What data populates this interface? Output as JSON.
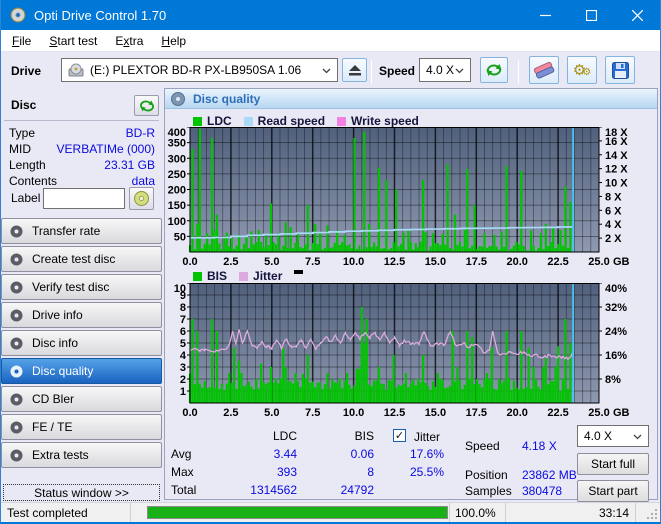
{
  "window": {
    "title": "Opti Drive Control 1.70"
  },
  "menu": {
    "items": [
      {
        "label": "File",
        "accel_index": 0
      },
      {
        "label": "Start test",
        "accel_index": 0
      },
      {
        "label": "Extra",
        "accel_index": 1
      },
      {
        "label": "Help",
        "accel_index": 0
      }
    ]
  },
  "toolbar": {
    "drive_label": "Drive",
    "drive_value": "(E:)   PLEXTOR BD-R  PX-LB950SA 1.06",
    "speed_label": "Speed",
    "speed_value": "4.0 X"
  },
  "disc_panel": {
    "title": "Disc",
    "rows": [
      {
        "label": "Type",
        "value": "BD-R"
      },
      {
        "label": "MID",
        "value": "VERBATIMe (000)"
      },
      {
        "label": "Length",
        "value": "23.31 GB"
      },
      {
        "label": "Contents",
        "value": "data"
      }
    ],
    "label_field": {
      "label": "Label",
      "value": ""
    }
  },
  "sidebar": {
    "items": [
      {
        "label": "Transfer rate"
      },
      {
        "label": "Create test disc"
      },
      {
        "label": "Verify test disc"
      },
      {
        "label": "Drive info"
      },
      {
        "label": "Disc info"
      },
      {
        "label": "Disc quality",
        "selected": true
      },
      {
        "label": "CD Bler"
      },
      {
        "label": "FE / TE"
      },
      {
        "label": "Extra tests"
      }
    ]
  },
  "status_window_button": "Status window >>",
  "main": {
    "header": "Disc quality"
  },
  "stats": {
    "columns": {
      "ldc": "LDC",
      "bis": "BIS",
      "jitter": "Jitter"
    },
    "jitter_checked": true,
    "rows": [
      {
        "label": "Avg",
        "ldc": "3.44",
        "bis": "0.06",
        "jitter": "17.6%"
      },
      {
        "label": "Max",
        "ldc": "393",
        "bis": "8",
        "jitter": "25.5%"
      },
      {
        "label": "Total",
        "ldc": "1314562",
        "bis": "24792",
        "jitter": ""
      }
    ],
    "right": {
      "speed_label": "Speed",
      "speed_value": "4.18 X",
      "position_label": "Position",
      "position_value": "23862 MB",
      "samples_label": "Samples",
      "samples_value": "380478"
    },
    "speed_select": "4.0 X",
    "buttons": {
      "start_full": "Start full",
      "start_part": "Start part"
    }
  },
  "statusbar": {
    "status": "Test completed",
    "progress_percent": "100.0%",
    "progress_value": 100,
    "elapsed": "33:14"
  },
  "chart_data": [
    {
      "type": "bar",
      "title": "Disc quality - LDC / Read speed / Write speed",
      "legend": [
        {
          "label": "LDC",
          "color": "#00c400"
        },
        {
          "label": "Read speed",
          "color": "#a8daf8"
        },
        {
          "label": "Write speed",
          "color": "#f281e4"
        }
      ],
      "x_axis": {
        "unit": "GB",
        "min": 0,
        "max": 25,
        "major_tick": 2.5,
        "minor_tick": 0.5,
        "ticks": [
          "0.0",
          "2.5",
          "5.0",
          "7.5",
          "10.0",
          "12.5",
          "15.0",
          "17.5",
          "20.0",
          "22.5",
          "25.0"
        ]
      },
      "left_axis": {
        "min": 0,
        "max": 400,
        "tick_step": 50
      },
      "right_axis": {
        "min": 0,
        "max": 18,
        "tick_step": 2,
        "suffix": " X"
      },
      "data_end_gb": 23.35,
      "plot_colors": {
        "bg_top": "#50607c",
        "bg_bottom": "#8f99b0"
      },
      "series": {
        "bars": {
          "name": "LDC",
          "color": "#00c400",
          "axis": "left",
          "step_gb": 0.15,
          "seed": 42,
          "baseline": [
            3,
            34
          ],
          "spikes": [
            [
              0.2,
              330
            ],
            [
              0.4,
              90
            ],
            [
              0.6,
              395
            ],
            [
              1.0,
              60
            ],
            [
              1.4,
              365
            ],
            [
              1.6,
              120
            ],
            [
              2.2,
              62
            ],
            [
              2.6,
              48
            ],
            [
              3.0,
              55
            ],
            [
              3.4,
              50
            ],
            [
              3.8,
              66
            ],
            [
              4.2,
              70
            ],
            [
              4.6,
              55
            ],
            [
              4.9,
              155
            ],
            [
              5.4,
              60
            ],
            [
              5.8,
              95
            ],
            [
              6.2,
              80
            ],
            [
              6.6,
              58
            ],
            [
              7.2,
              150
            ],
            [
              7.6,
              90
            ],
            [
              8.0,
              62
            ],
            [
              8.4,
              85
            ],
            [
              9.0,
              70
            ],
            [
              9.4,
              55
            ],
            [
              10.0,
              365
            ],
            [
              10.6,
              385
            ],
            [
              11.0,
              90
            ],
            [
              11.6,
              270
            ],
            [
              12.0,
              230
            ],
            [
              12.6,
              200
            ],
            [
              13.0,
              62
            ],
            [
              13.4,
              70
            ],
            [
              14.2,
              230
            ],
            [
              14.8,
              60
            ],
            [
              15.4,
              58
            ],
            [
              15.8,
              280
            ],
            [
              16.2,
              120
            ],
            [
              16.8,
              70
            ],
            [
              17.0,
              265
            ],
            [
              17.4,
              150
            ],
            [
              18.0,
              60
            ],
            [
              18.6,
              55
            ],
            [
              19.0,
              65
            ],
            [
              19.4,
              275
            ],
            [
              20.2,
              260
            ],
            [
              20.8,
              70
            ],
            [
              21.4,
              60
            ],
            [
              21.8,
              90
            ],
            [
              22.2,
              80
            ],
            [
              22.6,
              70
            ],
            [
              23.0,
              210
            ],
            [
              23.2,
              160
            ]
          ]
        },
        "lines": [
          {
            "name": "Read speed",
            "color": "#a8daf8",
            "axis": "right",
            "mode": "step",
            "width": 1.7,
            "points": [
              [
                0,
                2.05
              ],
              [
                1.5,
                2.1
              ],
              [
                2.5,
                2.25
              ],
              [
                3.5,
                2.4
              ],
              [
                4.5,
                2.5
              ],
              [
                5.5,
                2.6
              ],
              [
                6.5,
                2.7
              ],
              [
                7.5,
                2.8
              ],
              [
                8.5,
                2.9
              ],
              [
                9.5,
                3.0
              ],
              [
                10.5,
                3.05
              ],
              [
                11.5,
                3.12
              ],
              [
                12.5,
                3.2
              ],
              [
                13.5,
                3.25
              ],
              [
                14.5,
                3.3
              ],
              [
                15.5,
                3.35
              ],
              [
                16.5,
                3.4
              ],
              [
                17.5,
                3.42
              ],
              [
                18.5,
                3.45
              ],
              [
                19.5,
                3.5
              ],
              [
                20.5,
                3.52
              ],
              [
                21.5,
                3.55
              ],
              [
                22.5,
                3.6
              ],
              [
                23.35,
                3.62
              ]
            ]
          },
          {
            "name": "Write speed",
            "color": "#f281e4",
            "axis": "right",
            "mode": "step",
            "width": 1.7,
            "points": []
          }
        ],
        "end_marker": {
          "color": "#45c8f8",
          "x_gb": 23.42
        }
      }
    },
    {
      "type": "bar",
      "title": "Disc quality - BIS / Jitter",
      "legend": [
        {
          "label": "BIS",
          "color": "#00c400"
        },
        {
          "label": "Jitter",
          "color": "#dcaade"
        }
      ],
      "x_axis": {
        "unit": "GB",
        "min": 0,
        "max": 25,
        "major_tick": 2.5,
        "minor_tick": 0.5,
        "ticks": [
          "0.0",
          "2.5",
          "5.0",
          "7.5",
          "10.0",
          "12.5",
          "15.0",
          "17.5",
          "20.0",
          "22.5",
          "25.0"
        ]
      },
      "left_axis": {
        "min": 0,
        "max": 10,
        "tick_step": 1
      },
      "right_axis": {
        "min": 0,
        "max": 40,
        "tick_step": 8,
        "suffix": "%"
      },
      "data_end_gb": 23.35,
      "plot_colors": {
        "bg_top": "#50607c",
        "bg_bottom": "#8f99b0"
      },
      "series": {
        "bars": {
          "name": "BIS",
          "color": "#00c400",
          "axis": "left",
          "step_gb": 0.15,
          "seed": 7,
          "baseline": [
            1,
            2.1
          ],
          "spikes": [
            [
              0.2,
              7
            ],
            [
              0.5,
              6
            ],
            [
              1.4,
              7
            ],
            [
              1.6,
              6
            ],
            [
              2.4,
              2.5
            ],
            [
              3.2,
              2.5
            ],
            [
              4.9,
              3
            ],
            [
              5.9,
              3
            ],
            [
              6.4,
              2.5
            ],
            [
              7.2,
              4
            ],
            [
              8.4,
              2.5
            ],
            [
              9.6,
              2.5
            ],
            [
              10.5,
              8
            ],
            [
              10.8,
              7
            ],
            [
              11.6,
              3
            ],
            [
              12.4,
              4
            ],
            [
              13.2,
              2.5
            ],
            [
              14.2,
              4
            ],
            [
              15.2,
              2.5
            ],
            [
              16.0,
              6
            ],
            [
              16.4,
              3
            ],
            [
              17.0,
              6
            ],
            [
              17.3,
              5.5
            ],
            [
              18.2,
              2.5
            ],
            [
              19.4,
              6
            ],
            [
              20.2,
              6
            ],
            [
              21.0,
              3
            ],
            [
              21.6,
              3
            ],
            [
              22.4,
              3
            ],
            [
              23.0,
              7
            ],
            [
              23.2,
              5
            ]
          ]
        },
        "lines": [
          {
            "name": "Jitter",
            "color": "#dcaade",
            "axis": "right",
            "mode": "noisy",
            "width": 1.3,
            "noise": 1.2,
            "seed": 11,
            "points": [
              [
                0,
                17.5
              ],
              [
                0.3,
                18.2
              ],
              [
                0.6,
                17.2
              ],
              [
                0.9,
                18.0
              ],
              [
                1.2,
                17.4
              ],
              [
                1.5,
                17.0
              ],
              [
                1.8,
                17.6
              ],
              [
                2.1,
                17.8
              ],
              [
                2.4,
                19.5
              ],
              [
                2.6,
                24.0
              ],
              [
                2.8,
                19.8
              ],
              [
                3.0,
                24.5
              ],
              [
                3.2,
                20.0
              ],
              [
                3.5,
                24.0
              ],
              [
                3.8,
                19.0
              ],
              [
                4.1,
                18.2
              ],
              [
                4.4,
                20.5
              ],
              [
                4.7,
                18.6
              ],
              [
                5.0,
                18.4
              ],
              [
                5.3,
                21.0
              ],
              [
                5.6,
                18.2
              ],
              [
                5.9,
                21.5
              ],
              [
                6.2,
                18.6
              ],
              [
                6.5,
                19.0
              ],
              [
                6.8,
                21.0
              ],
              [
                7.1,
                18.4
              ],
              [
                7.4,
                21.0
              ],
              [
                7.7,
                18.2
              ],
              [
                8.0,
                20.0
              ],
              [
                8.3,
                22.0
              ],
              [
                8.6,
                20.5
              ],
              [
                8.9,
                22.5
              ],
              [
                9.2,
                20.0
              ],
              [
                9.5,
                23.0
              ],
              [
                9.8,
                21.0
              ],
              [
                10.1,
                23.5
              ],
              [
                10.4,
                21.5
              ],
              [
                10.7,
                23.5
              ],
              [
                11.0,
                22.0
              ],
              [
                11.3,
                23.5
              ],
              [
                11.6,
                21.0
              ],
              [
                11.9,
                23.0
              ],
              [
                12.2,
                20.0
              ],
              [
                12.5,
                22.0
              ],
              [
                12.8,
                19.0
              ],
              [
                13.1,
                21.0
              ],
              [
                13.5,
                19.5
              ],
              [
                14.0,
                20.0
              ],
              [
                14.3,
                23.8
              ],
              [
                14.7,
                19.0
              ],
              [
                15.1,
                20.0
              ],
              [
                15.5,
                19.2
              ],
              [
                15.9,
                23.5
              ],
              [
                16.3,
                19.0
              ],
              [
                16.7,
                20.0
              ],
              [
                17.1,
                18.6
              ],
              [
                17.5,
                19.5
              ],
              [
                17.9,
                17.0
              ],
              [
                18.3,
                17.6
              ],
              [
                18.5,
                24.0
              ],
              [
                18.8,
                16.8
              ],
              [
                19.2,
                16.4
              ],
              [
                19.6,
                17.0
              ],
              [
                20.0,
                16.2
              ],
              [
                20.4,
                17.0
              ],
              [
                20.8,
                15.6
              ],
              [
                21.2,
                16.2
              ],
              [
                21.6,
                15.2
              ],
              [
                22.0,
                16.0
              ],
              [
                22.4,
                15.0
              ],
              [
                22.8,
                15.6
              ],
              [
                23.1,
                14.6
              ],
              [
                23.35,
                16.5
              ]
            ]
          }
        ],
        "end_marker": {
          "color": "#45c8f8",
          "x_gb": 23.42
        }
      }
    }
  ]
}
